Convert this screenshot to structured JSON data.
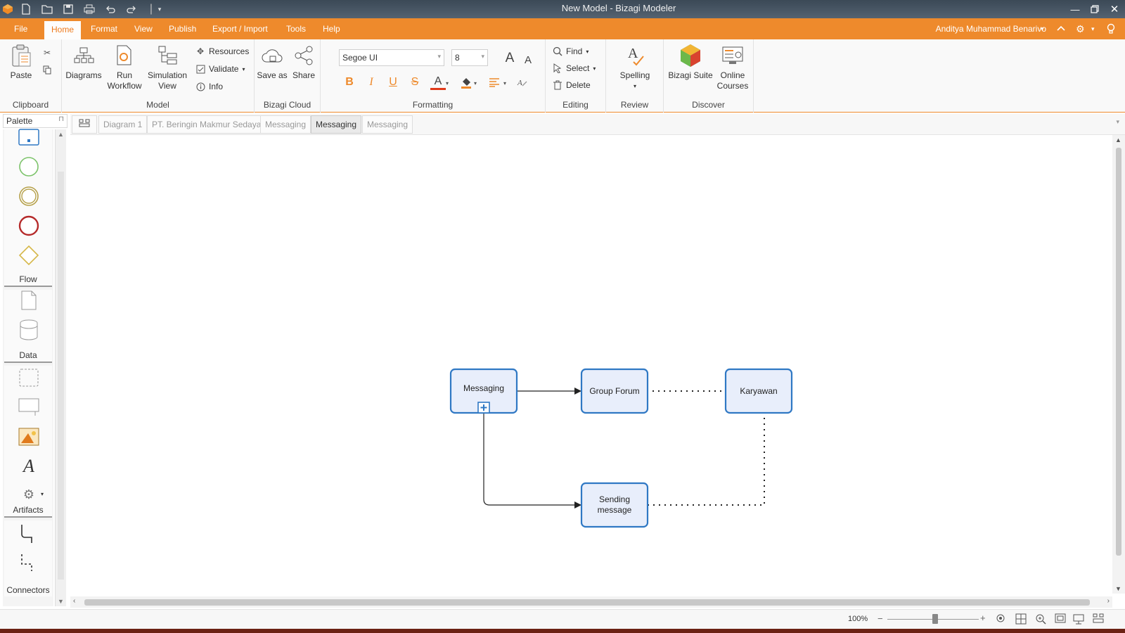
{
  "window": {
    "title": "New Model - Bizagi Modeler",
    "quick_access": [
      "app-logo-icon",
      "new-file-icon",
      "open-folder-icon",
      "save-icon",
      "print-icon",
      "undo-icon",
      "redo-icon",
      "customize-icon"
    ]
  },
  "menu": {
    "items": [
      "File",
      "Home",
      "Format",
      "View",
      "Publish",
      "Export / Import",
      "Tools",
      "Help"
    ],
    "active": "Home",
    "user": "Anditya Muhammad Benarivo"
  },
  "ribbon": {
    "clipboard": {
      "label": "Clipboard",
      "paste": "Paste"
    },
    "model": {
      "label": "Model",
      "diagrams": "Diagrams",
      "run_workflow_1": "Run",
      "run_workflow_2": "Workflow",
      "simulation_1": "Simulation",
      "simulation_2": "View",
      "resources": "Resources",
      "validate": "Validate",
      "info": "Info"
    },
    "cloud": {
      "label": "Bizagi Cloud",
      "save_as": "Save as",
      "share": "Share"
    },
    "formatting": {
      "label": "Formatting",
      "font": "Segoe UI",
      "size": "8",
      "bold": "B",
      "italic": "I",
      "underline": "U",
      "strike": "S",
      "font_color": "A"
    },
    "editing": {
      "label": "Editing",
      "find": "Find",
      "select": "Select",
      "delete": "Delete"
    },
    "review": {
      "label": "Review",
      "spelling": "Spelling"
    },
    "discover": {
      "label": "Discover",
      "suite": "Bizagi Suite",
      "courses_1": "Online",
      "courses_2": "Courses"
    }
  },
  "palette": {
    "title": "Palette",
    "sections": {
      "flow": "Flow",
      "data": "Data",
      "artifacts": "Artifacts",
      "connectors": "Connectors"
    }
  },
  "tabs": [
    "Diagram 1",
    "PT. Beringin Makmur Sedaya",
    "Messaging",
    "Messaging",
    "Messaging"
  ],
  "active_tab_index": 3,
  "diagram": {
    "tasks": {
      "messaging": "Messaging",
      "group_forum": "Group Forum",
      "karyawan": "Karyawan",
      "sending_1": "Sending",
      "sending_2": "message"
    }
  },
  "status": {
    "zoom": "100%",
    "zoom_level": 100
  },
  "colors": {
    "accent": "#ee8a2c",
    "task_fill": "#e8eefb",
    "task_stroke": "#2f78c4"
  }
}
